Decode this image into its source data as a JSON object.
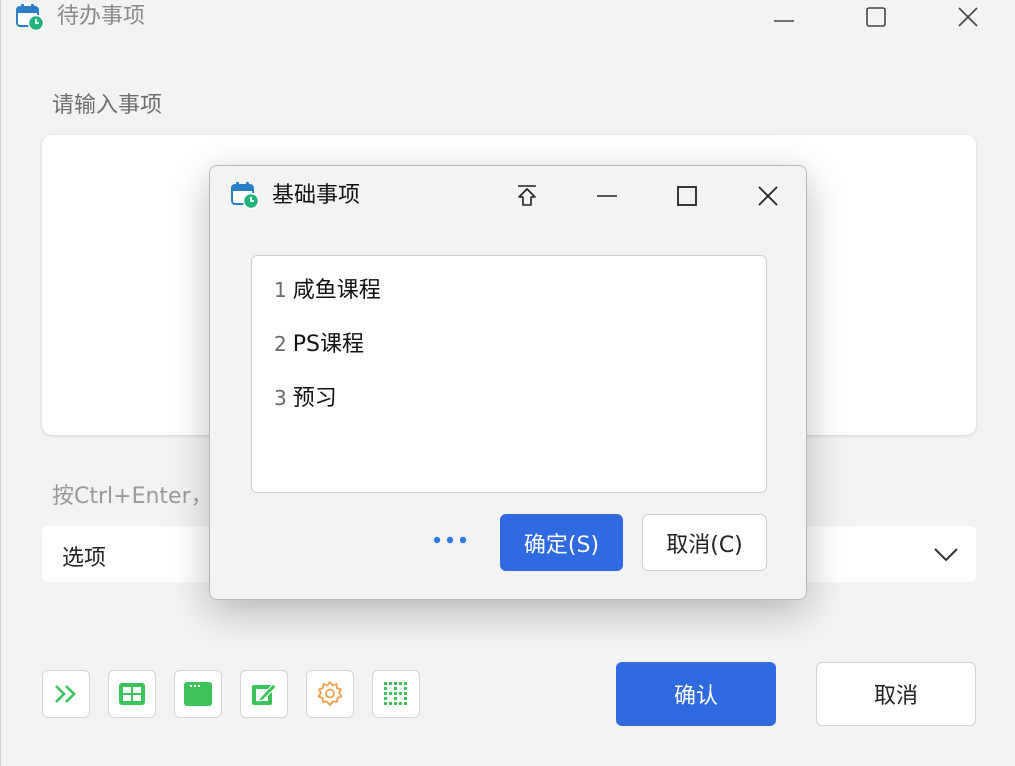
{
  "main": {
    "title": "待办事项",
    "input_label": "请输入事项",
    "input_value": "",
    "hint": "按Ctrl+Enter，",
    "select_value": "选项",
    "confirm_label": "确认",
    "cancel_label": "取消",
    "toolbar_icons": [
      "double-chevron-right-icon",
      "table-grid-icon",
      "window-icon",
      "edit-icon",
      "gear-icon",
      "dot-grid-icon"
    ]
  },
  "dialog": {
    "title": "基础事项",
    "items": [
      {
        "num": "1",
        "text": "咸鱼课程"
      },
      {
        "num": "2",
        "text": "PS课程"
      },
      {
        "num": "3",
        "text": "预习"
      }
    ],
    "more_label": "•••",
    "ok_label": "确定(S)",
    "cancel_label": "取消(C)"
  },
  "colors": {
    "accent": "#2f6ae1",
    "icon_green": "#3cc35a",
    "icon_orange": "#f0a04b",
    "more_blue": "#2f7be6"
  }
}
